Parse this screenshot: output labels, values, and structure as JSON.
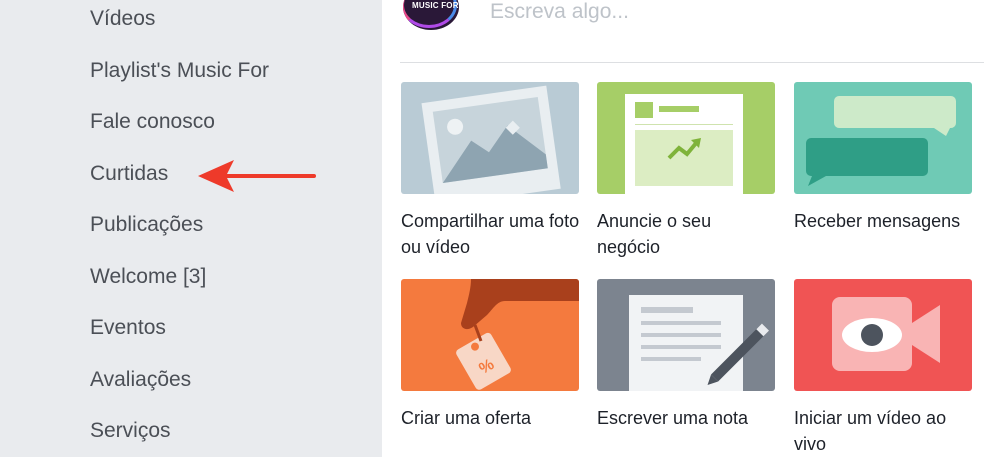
{
  "sidebar": {
    "items": [
      {
        "label": "Vídeos"
      },
      {
        "label": "Playlist's Music For"
      },
      {
        "label": "Fale conosco"
      },
      {
        "label": "Curtidas"
      },
      {
        "label": "Publicações"
      },
      {
        "label": "Welcome [3]"
      },
      {
        "label": "Eventos"
      },
      {
        "label": "Avaliações"
      },
      {
        "label": "Serviços"
      }
    ],
    "arrow_color": "#ee3a2a"
  },
  "composer": {
    "avatar_text": "MUSIC FOR",
    "placeholder": "Escreva algo..."
  },
  "actions": [
    {
      "label": "Compartilhar uma foto ou vídeo",
      "icon": "photo-icon",
      "color": "#b9cbd5"
    },
    {
      "label": "Anuncie o seu negócio",
      "icon": "advertise-icon",
      "color": "#a6ce67"
    },
    {
      "label": "Receber mensagens",
      "icon": "messages-icon",
      "color": "#6fcab5"
    },
    {
      "label": "Criar uma oferta",
      "icon": "offer-tag-icon",
      "color": "#f47a3e"
    },
    {
      "label": "Escrever uma nota",
      "icon": "note-icon",
      "color": "#7c848f"
    },
    {
      "label": "Iniciar um vídeo ao vivo",
      "icon": "live-video-icon",
      "color": "#f05454"
    }
  ]
}
